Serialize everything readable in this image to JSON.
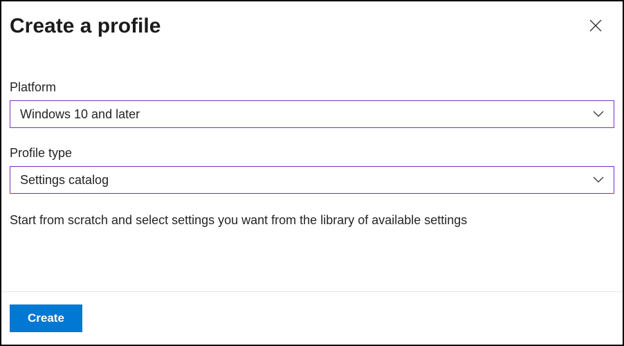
{
  "header": {
    "title": "Create a profile"
  },
  "fields": {
    "platform": {
      "label": "Platform",
      "value": "Windows 10 and later"
    },
    "profileType": {
      "label": "Profile type",
      "value": "Settings catalog"
    }
  },
  "description": "Start from scratch and select settings you want from the library of available settings",
  "footer": {
    "createLabel": "Create"
  },
  "colors": {
    "accent": "#0078d4",
    "selectBorder": "#7b2fbf"
  }
}
